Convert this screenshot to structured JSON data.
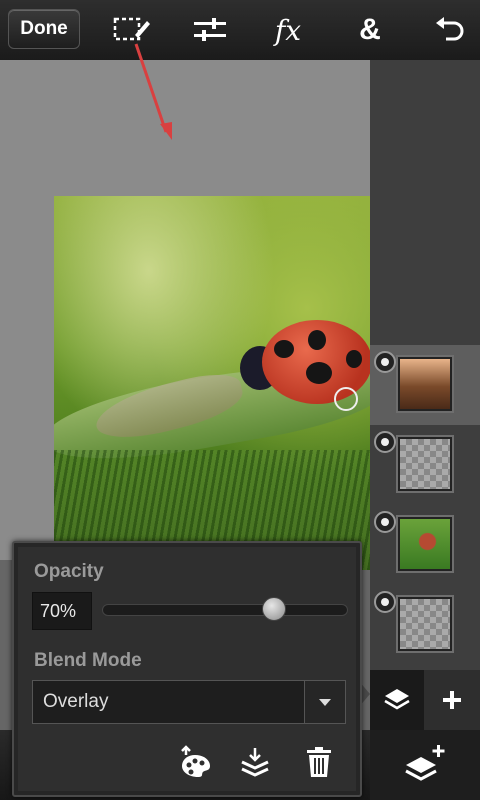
{
  "toolbar": {
    "done_label": "Done",
    "icons": [
      "selection-edit-icon",
      "adjustments-icon",
      "fx-icon",
      "ampersand-icon",
      "undo-icon"
    ],
    "fx_glyph": "fx",
    "amp_glyph": "&"
  },
  "layers": [
    {
      "thumb": "photo-texture",
      "selected": true
    },
    {
      "thumb": "transparent",
      "selected": false
    },
    {
      "thumb": "ladybug-photo",
      "selected": false
    },
    {
      "thumb": "transparent",
      "selected": false
    }
  ],
  "properties": {
    "opacity_label": "Opacity",
    "opacity_value": "70%",
    "opacity_fraction": 0.7,
    "blend_label": "Blend Mode",
    "blend_value": "Overlay",
    "actions": [
      "paint-palette-icon",
      "merge-down-icon",
      "trash-icon"
    ]
  },
  "colors": {
    "accent_arrow": "#d94040",
    "toolbar_bg": "#1e1e1e",
    "panel_bg": "#3e3e3e"
  }
}
